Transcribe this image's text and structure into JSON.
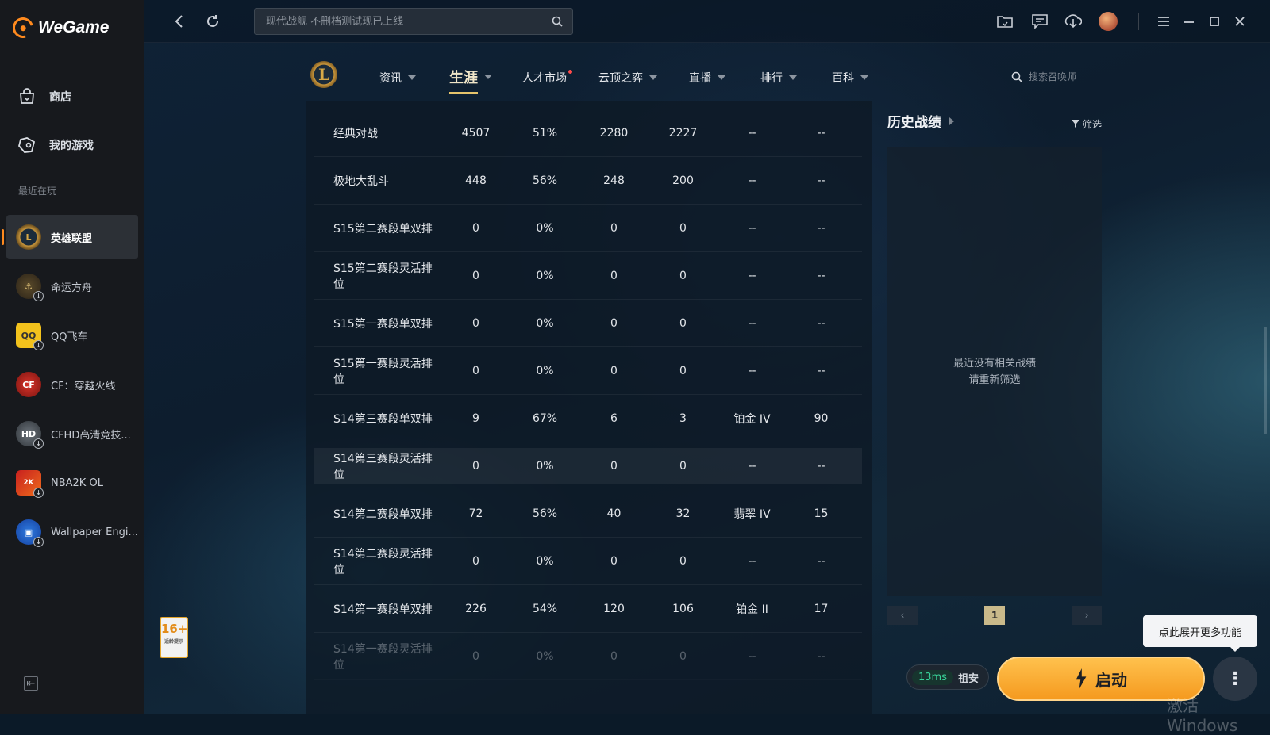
{
  "app": {
    "brand": "WeGame",
    "accent_color": "#ff8a1e"
  },
  "sidebar": {
    "nav": [
      {
        "label": "商店",
        "icon": "store-bag-icon"
      },
      {
        "label": "我的游戏",
        "icon": "gamepad-icon"
      }
    ],
    "section_label": "最近在玩",
    "games": [
      {
        "label": "英雄联盟",
        "active": true
      },
      {
        "label": "命运方舟"
      },
      {
        "label": "QQ飞车"
      },
      {
        "label": "CF：穿越火线"
      },
      {
        "label": "CFHD高清竞技..."
      },
      {
        "label": "NBA2K OL"
      },
      {
        "label": "Wallpaper Engi..."
      }
    ],
    "age_rating": "16+",
    "age_note": "适龄提示"
  },
  "topbar": {
    "search_placeholder": "现代战舰 不删档测试现已上线"
  },
  "subnav": {
    "tabs": [
      {
        "label": "资讯"
      },
      {
        "label": "生涯",
        "active": true
      },
      {
        "label": "人才市场"
      },
      {
        "label": "云顶之弈"
      },
      {
        "label": "直播"
      },
      {
        "label": "排行"
      },
      {
        "label": "百科"
      }
    ],
    "summoner_search_placeholder": "搜索召唤师"
  },
  "table": {
    "rows": [
      [
        "经典对战",
        "4507",
        "51%",
        "2280",
        "2227",
        "--",
        "--"
      ],
      [
        "极地大乱斗",
        "448",
        "56%",
        "248",
        "200",
        "--",
        "--"
      ],
      [
        "S15第二赛段单双排",
        "0",
        "0%",
        "0",
        "0",
        "--",
        "--"
      ],
      [
        "S15第二赛段灵活排位",
        "0",
        "0%",
        "0",
        "0",
        "--",
        "--"
      ],
      [
        "S15第一赛段单双排",
        "0",
        "0%",
        "0",
        "0",
        "--",
        "--"
      ],
      [
        "S15第一赛段灵活排位",
        "0",
        "0%",
        "0",
        "0",
        "--",
        "--"
      ],
      [
        "S14第三赛段单双排",
        "9",
        "67%",
        "6",
        "3",
        "铂金 IV",
        "90"
      ],
      [
        "S14第三赛段灵活排位",
        "0",
        "0%",
        "0",
        "0",
        "--",
        "--"
      ],
      [
        "S14第二赛段单双排",
        "72",
        "56%",
        "40",
        "32",
        "翡翠 IV",
        "15"
      ],
      [
        "S14第二赛段灵活排位",
        "0",
        "0%",
        "0",
        "0",
        "--",
        "--"
      ],
      [
        "S14第一赛段单双排",
        "226",
        "54%",
        "120",
        "106",
        "铂金 II",
        "17"
      ],
      [
        "S14第一赛段灵活排位",
        "0",
        "0%",
        "0",
        "0",
        "--",
        "--"
      ]
    ]
  },
  "history": {
    "title": "历史战绩",
    "filter_label": "筛选",
    "empty_line1": "最近没有相关战绩",
    "empty_line2": "请重新筛选",
    "page": "1"
  },
  "bottom": {
    "ping": "13ms",
    "server": "祖安",
    "launch_label": "启动",
    "tooltip": "点此展开更多功能",
    "watermark": "激活 Windows"
  }
}
